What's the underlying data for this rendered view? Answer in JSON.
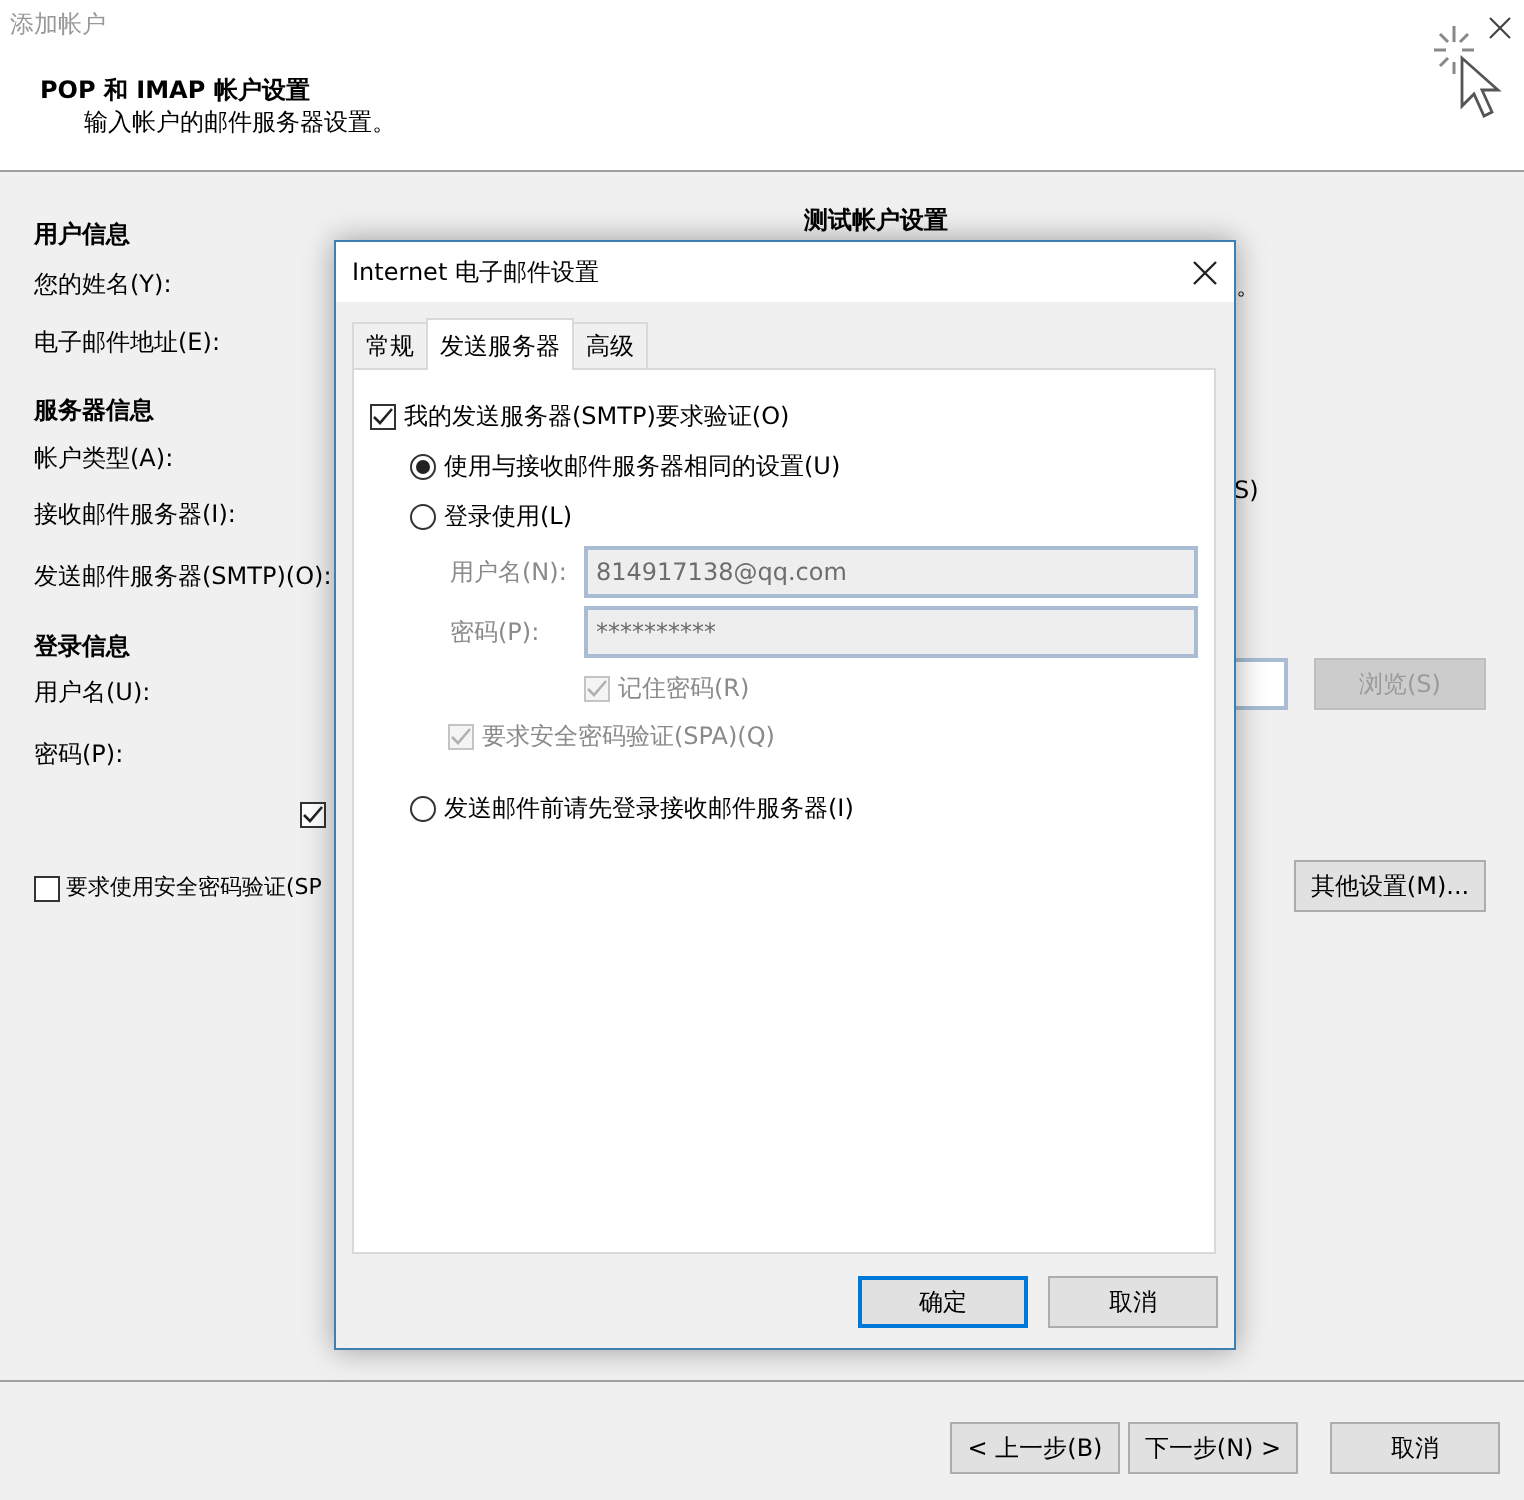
{
  "window": {
    "title": "添加帐户"
  },
  "header": {
    "title": "POP 和 IMAP 帐户设置",
    "subtitle": "输入帐户的邮件服务器设置。"
  },
  "form": {
    "rows": [
      {
        "kind": "heading",
        "text": "用户信息"
      },
      {
        "kind": "label",
        "text": "您的姓名(Y):"
      },
      {
        "kind": "label",
        "text": "电子邮件地址(E):"
      },
      {
        "kind": "heading",
        "text": "服务器信息"
      },
      {
        "kind": "label",
        "text": "帐户类型(A):"
      },
      {
        "kind": "label",
        "text": "接收邮件服务器(I):"
      },
      {
        "kind": "label",
        "text": "发送邮件服务器(SMTP)(O):"
      },
      {
        "kind": "heading",
        "text": "登录信息"
      },
      {
        "kind": "label",
        "text": "用户名(U):"
      },
      {
        "kind": "label",
        "text": "密码(P):"
      },
      {
        "kind": "checkbox",
        "checked": true
      },
      {
        "kind": "checkbox",
        "text": "要求使用安全密码验证(SP",
        "checked": false
      }
    ]
  },
  "test_section": {
    "heading": "测试帐户设置",
    "fragment_1": "。",
    "fragment_2": "S)",
    "browse_button": {
      "label": "浏览(S)",
      "disabled": true
    },
    "more_button": "其他设置(M)..."
  },
  "dialog": {
    "title": "Internet 电子邮件设置",
    "tabs": [
      {
        "label": "常规",
        "selected": false
      },
      {
        "label": "发送服务器",
        "selected": true
      },
      {
        "label": "高级",
        "selected": false
      }
    ],
    "smtp_auth": {
      "label": "我的发送服务器(SMTP)要求验证(O)",
      "checked": true
    },
    "options": [
      {
        "label": "使用与接收邮件服务器相同的设置(U)",
        "selected": true
      },
      {
        "label": "登录使用(L)",
        "selected": false,
        "children": [
          {
            "kind": "field",
            "label": "用户名(N):",
            "value": "814917138@qq.com",
            "disabled": true
          },
          {
            "kind": "field",
            "label": "密码(P):",
            "value": "**********",
            "disabled": true
          },
          {
            "kind": "field-checkbox",
            "label": "记住密码(R)",
            "checked": true,
            "disabled": true
          },
          {
            "kind": "checkbox",
            "label": "要求安全密码验证(SPA)(Q)",
            "checked": true,
            "disabled": true
          }
        ]
      },
      {
        "label": "发送邮件前请先登录接收邮件服务器(I)",
        "selected": false
      }
    ],
    "buttons": [
      {
        "label": "确定",
        "default": true
      },
      {
        "label": "取消",
        "default": false
      }
    ]
  },
  "wizard_buttons": [
    "< 上一步(B)",
    "下一步(N) >",
    "取消"
  ]
}
